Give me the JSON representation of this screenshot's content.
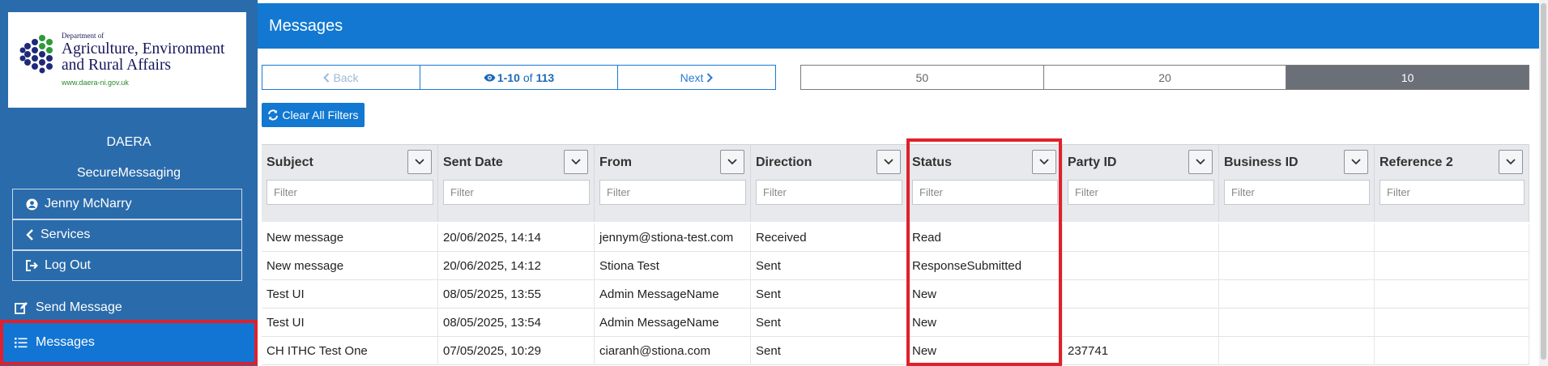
{
  "logo": {
    "small": "Department of",
    "line1": "Agriculture, Environment",
    "line2": "and Rural Affairs",
    "url": "www.daera-ni.gov.uk"
  },
  "sidebar": {
    "org": "DAERA",
    "app": "SecureMessaging",
    "user": "Jenny McNarry",
    "services": "Services",
    "logout": "Log Out",
    "send": "Send Message",
    "messages": "Messages"
  },
  "header": {
    "title": "Messages"
  },
  "pager": {
    "back": "Back",
    "range": "1-10",
    "of": "of",
    "total": "113",
    "next": "Next"
  },
  "page_sizes": [
    "50",
    "20",
    "10"
  ],
  "selected_page_size": "10",
  "clear_filters": "Clear All Filters",
  "table": {
    "filter_placeholder": "Filter",
    "columns": [
      "Subject",
      "Sent Date",
      "From",
      "Direction",
      "Status",
      "Party ID",
      "Business ID",
      "Reference 2"
    ],
    "rows": [
      [
        "New message",
        "20/06/2025, 14:14",
        "jennym@stiona-test.com",
        "Received",
        "Read",
        "",
        "",
        ""
      ],
      [
        "New message",
        "20/06/2025, 14:12",
        "Stiona Test",
        "Sent",
        "ResponseSubmitted",
        "",
        "",
        ""
      ],
      [
        "Test UI",
        "08/05/2025, 13:55",
        "Admin MessageName",
        "Sent",
        "New",
        "",
        "",
        ""
      ],
      [
        "Test UI",
        "08/05/2025, 13:54",
        "Admin MessageName",
        "Sent",
        "New",
        "",
        "",
        ""
      ],
      [
        "CH ITHC Test One",
        "07/05/2025, 10:29",
        "ciaranh@stiona.com",
        "Sent",
        "New",
        "237741",
        "",
        ""
      ]
    ]
  },
  "colors": {
    "brand_blue": "#1278d2",
    "sidebar": "#2a6bab",
    "highlight": "#e0202a",
    "selected_size": "#6b7078"
  }
}
